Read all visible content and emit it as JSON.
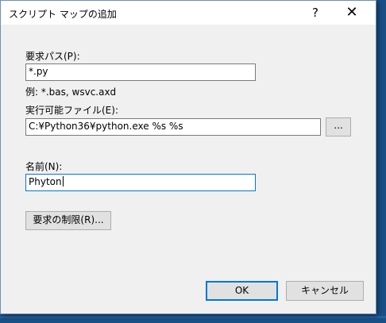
{
  "window": {
    "title": "スクリプト マップの追加",
    "help_label": "?",
    "close_label": "✕"
  },
  "request_path": {
    "label": "要求パス(P):",
    "value": "*.py",
    "example": "例: *.bas, wsvc.axd"
  },
  "executable": {
    "label": "実行可能ファイル(E):",
    "value": "C:¥Python36¥python.exe %s %s",
    "browse_label": "..."
  },
  "name": {
    "label": "名前(N):",
    "value": "Phyton"
  },
  "buttons": {
    "restrictions": "要求の制限(R)...",
    "ok": "OK",
    "cancel": "キャンセル"
  },
  "colors": {
    "desktop": "#1a4f86",
    "dialog_bg": "#f0f0f0",
    "focus_border": "#0078d7"
  }
}
